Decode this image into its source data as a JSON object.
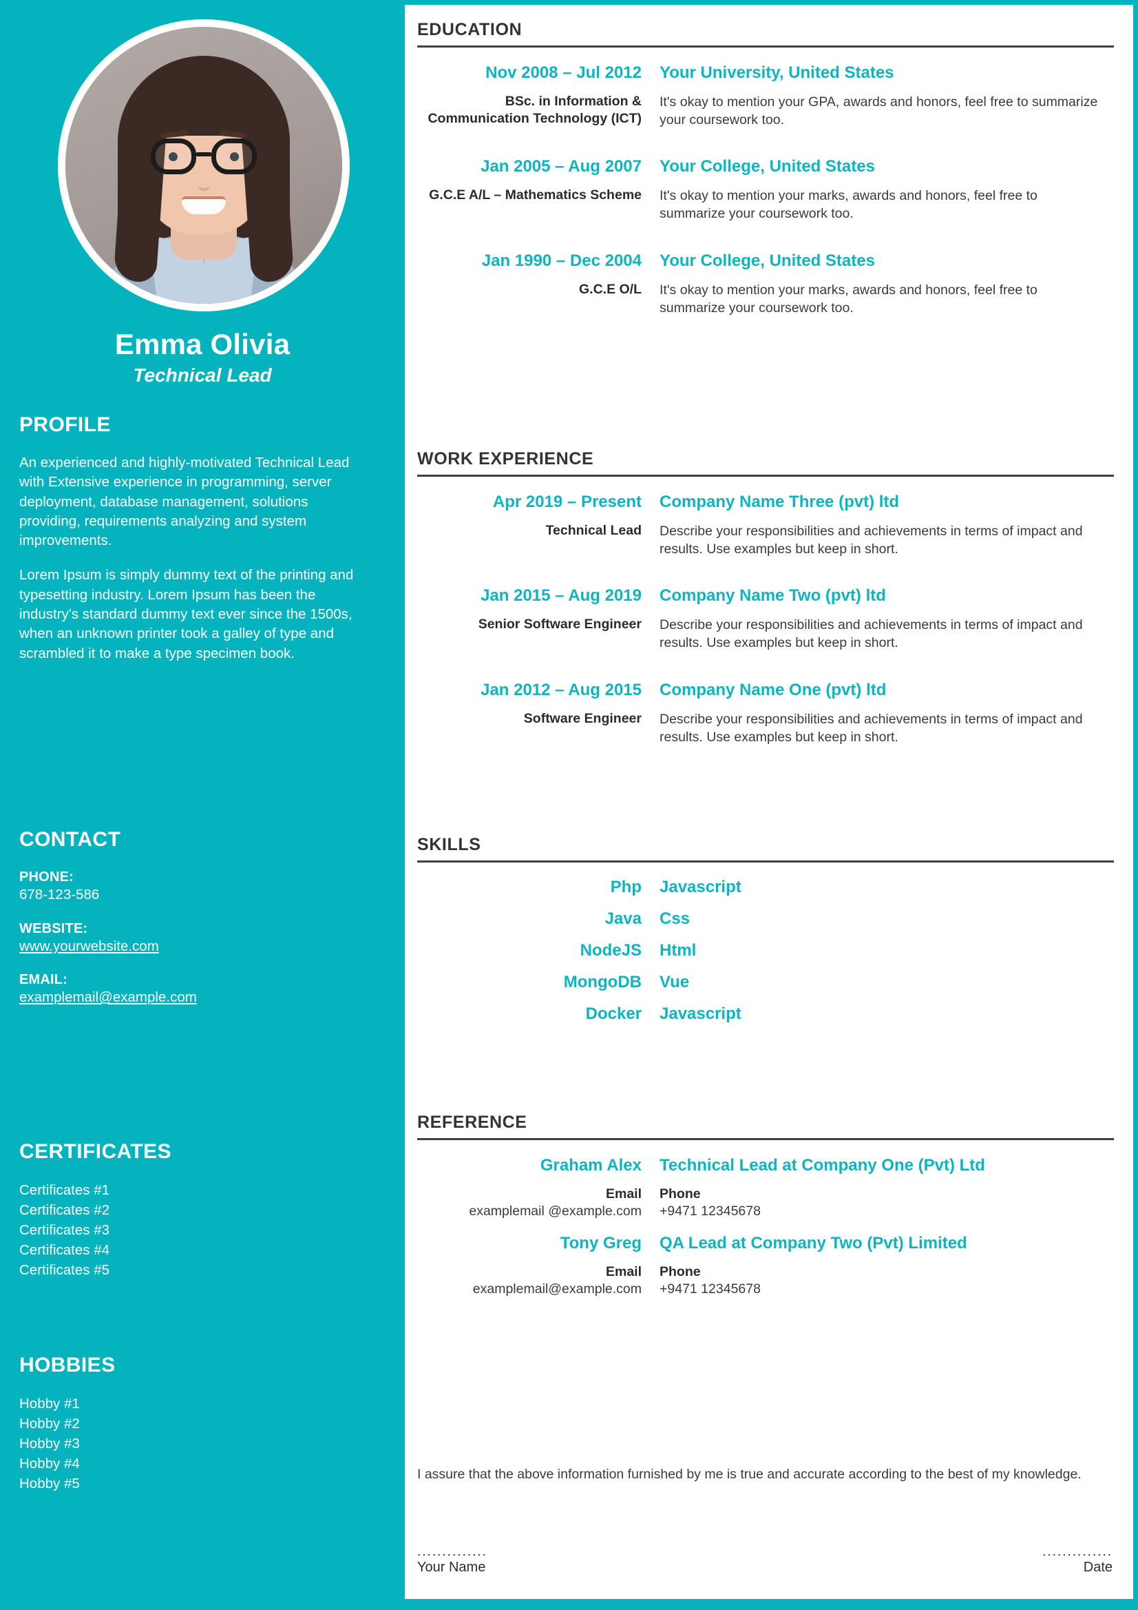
{
  "theme": {
    "teal": "#04B3BE",
    "accent": "#0CB6C0",
    "dark": "#333333",
    "body_text": "#3A3A3A",
    "white": "#FFFFFF"
  },
  "sidebar": {
    "photo_alt": "profile-photo",
    "name": "Emma Olivia",
    "role": "Technical Lead",
    "profile": {
      "title": "PROFILE",
      "paragraphs": [
        "An experienced and highly-motivated Technical Lead with Extensive experience in programming, server deployment, database management, solutions providing, requirements analyzing and system improvements.",
        "Lorem Ipsum is simply dummy text of the printing and typesetting industry. Lorem Ipsum has been the industry's standard dummy text ever since the 1500s, when an unknown printer took a galley of type and scrambled it to make a type specimen book."
      ]
    },
    "contact": {
      "title": "CONTACT",
      "fields": [
        {
          "label": "PHONE:",
          "value": "678-123-586",
          "is_link": false
        },
        {
          "label": "WEBSITE:",
          "value": "www.yourwebsite.com",
          "is_link": true
        },
        {
          "label": "EMAIL:",
          "value": "examplemail@example.com",
          "is_link": true
        }
      ]
    },
    "certificates": {
      "title": "CERTIFICATES",
      "items": [
        "Certificates #1",
        "Certificates #2",
        "Certificates #3",
        "Certificates #4",
        "Certificates #5"
      ]
    },
    "hobbies": {
      "title": "HOBBIES",
      "items": [
        "Hobby #1",
        "Hobby #2",
        "Hobby #3",
        "Hobby #4",
        "Hobby #5"
      ]
    }
  },
  "main": {
    "education": {
      "title": "EDUCATION",
      "entries": [
        {
          "date": "Nov 2008 – Jul 2012",
          "org": "Your University, United States",
          "sub": "BSc. in Information & Communication Technology (ICT)",
          "desc": "It's okay to mention your GPA, awards and honors, feel free to summarize your coursework too."
        },
        {
          "date": "Jan  2005 – Aug 2007",
          "org": "Your College, United States",
          "sub": "G.C.E A/L – Mathematics Scheme",
          "desc": "It's okay to mention your marks, awards and honors, feel free to summarize your coursework too."
        },
        {
          "date": "Jan 1990 – Dec 2004",
          "org": "Your College, United States",
          "sub": "G.C.E O/L",
          "desc": "It's okay to mention your marks, awards and honors, feel free to summarize your coursework too."
        }
      ]
    },
    "work": {
      "title": "WORK EXPERIENCE",
      "entries": [
        {
          "date": "Apr 2019 – Present",
          "org": "Company Name Three (pvt) ltd",
          "sub": "Technical Lead",
          "desc": "Describe your responsibilities and achievements in terms of impact and results. Use examples but keep in short."
        },
        {
          "date": "Jan 2015 – Aug 2019",
          "org": "Company Name Two (pvt) ltd",
          "sub": "Senior Software Engineer",
          "desc": "Describe your responsibilities and achievements in terms of impact and results. Use examples but keep in short."
        },
        {
          "date": "Jan 2012 – Aug 2015",
          "org": "Company Name One (pvt) ltd",
          "sub": "Software Engineer",
          "desc": "Describe your responsibilities and achievements in terms of impact and results. Use examples but keep in short."
        }
      ]
    },
    "skills": {
      "title": "SKILLS",
      "rows": [
        {
          "left": "Php",
          "right": "Javascript"
        },
        {
          "left": "Java",
          "right": "Css"
        },
        {
          "left": "NodeJS",
          "right": "Html"
        },
        {
          "left": "MongoDB",
          "right": "Vue"
        },
        {
          "left": "Docker",
          "right": "Javascript"
        }
      ]
    },
    "reference": {
      "title": "REFERENCE",
      "entries": [
        {
          "name": "Graham Alex",
          "position": "Technical Lead at Company One (Pvt) Ltd",
          "email_label": "Email",
          "email_value": "examplemail @example.com",
          "phone_label": "Phone",
          "phone_value": "+9471 12345678"
        },
        {
          "name": "Tony Greg",
          "position": "QA Lead at Company Two (Pvt) Limited",
          "email_label": "Email",
          "email_value": "examplemail@example.com",
          "phone_label": "Phone",
          "phone_value": "+9471 12345678"
        }
      ]
    },
    "footer": {
      "statement": "I assure that the above information furnished by me is true and accurate according to the best of my knowledge.",
      "dots": "..............",
      "name_label": "Your Name",
      "date_label": "Date"
    }
  }
}
